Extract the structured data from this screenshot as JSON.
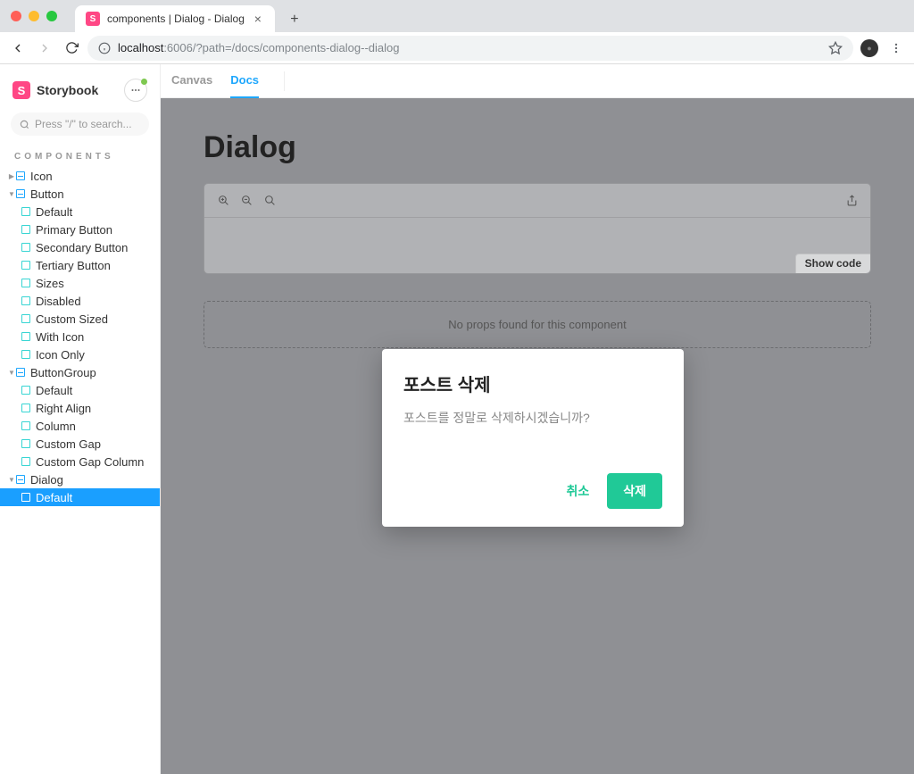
{
  "browser": {
    "tab_title": "components | Dialog - Dialog",
    "url_scheme_icon": "info-icon",
    "url_host": "localhost",
    "url_port_path": ":6006/?path=/docs/components-dialog--dialog"
  },
  "sidebar": {
    "logo_text": "Storybook",
    "search_placeholder": "Press \"/\" to search...",
    "section_label": "COMPONENTS",
    "tree": {
      "icon": {
        "label": "Icon",
        "expanded": false
      },
      "button": {
        "label": "Button",
        "items": [
          "Default",
          "Primary Button",
          "Secondary Button",
          "Tertiary Button",
          "Sizes",
          "Disabled",
          "Custom Sized",
          "With Icon",
          "Icon Only"
        ]
      },
      "buttongroup": {
        "label": "ButtonGroup",
        "items": [
          "Default",
          "Right Align",
          "Column",
          "Custom Gap",
          "Custom Gap Column"
        ]
      },
      "dialog": {
        "label": "Dialog",
        "items": [
          "Default"
        ]
      }
    }
  },
  "main": {
    "tabs": {
      "canvas": "Canvas",
      "docs": "Docs"
    },
    "doc_title": "Dialog",
    "show_code_label": "Show code",
    "props_message": "No props found for this component"
  },
  "dialog": {
    "title": "포스트 삭제",
    "body": "포스트를 정말로 삭제하시겠습니까?",
    "cancel": "취소",
    "confirm": "삭제"
  }
}
